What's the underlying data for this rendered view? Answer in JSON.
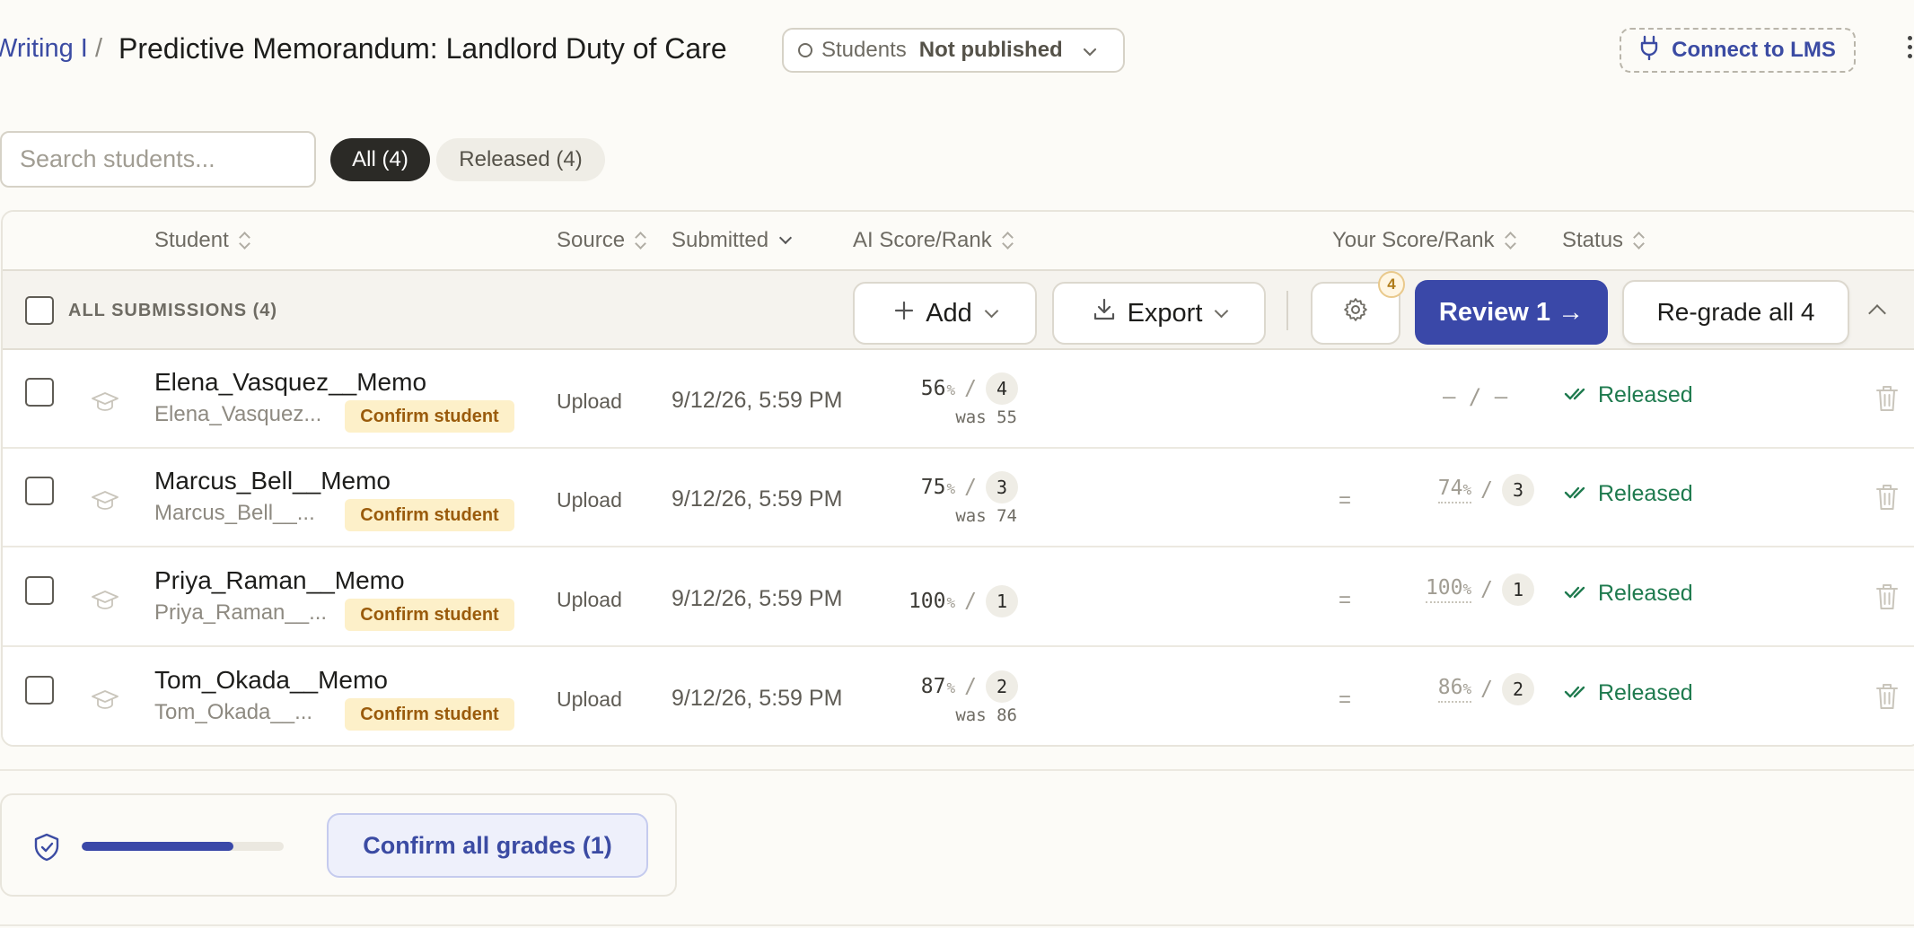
{
  "header": {
    "breadcrumb_parent": "Writing I",
    "breadcrumb_separator": "/",
    "title": "Predictive Memorandum: Landlord Duty of Care",
    "publish_audience": "Students",
    "publish_status": "Not published",
    "connect_lms_label": "Connect to LMS"
  },
  "filters": {
    "search_placeholder": "Search students...",
    "all_label": "All (4)",
    "released_label": "Released (4)"
  },
  "columns": {
    "student": "Student",
    "source": "Source",
    "submitted": "Submitted",
    "ai_score": "AI Score/Rank",
    "your_score": "Your Score/Rank",
    "status": "Status"
  },
  "toolbar": {
    "all_submissions": "ALL SUBMISSIONS (4)",
    "add_label": "Add",
    "export_label": "Export",
    "settings_badge": "4",
    "review_label": "Review 1 →",
    "regrade_label": "Re-grade all 4"
  },
  "rows": [
    {
      "file": "Elena_Vasquez__Memo",
      "sub": "Elena_Vasquez...",
      "confirm": "Confirm student",
      "source": "Upload",
      "submitted": "9/12/26, 5:59 PM",
      "ai_score": "56",
      "ai_rank": "4",
      "was": "was 55",
      "eq": "",
      "your_score": "",
      "your_rank": "",
      "your_empty": "– / –",
      "status": "Released"
    },
    {
      "file": "Marcus_Bell__Memo",
      "sub": "Marcus_Bell__...",
      "confirm": "Confirm student",
      "source": "Upload",
      "submitted": "9/12/26, 5:59 PM",
      "ai_score": "75",
      "ai_rank": "3",
      "was": "was 74",
      "eq": "=",
      "your_score": "74",
      "your_rank": "3",
      "your_empty": "",
      "status": "Released"
    },
    {
      "file": "Priya_Raman__Memo",
      "sub": "Priya_Raman__...",
      "confirm": "Confirm student",
      "source": "Upload",
      "submitted": "9/12/26, 5:59 PM",
      "ai_score": "100",
      "ai_rank": "1",
      "was": "",
      "eq": "=",
      "your_score": "100",
      "your_rank": "1",
      "your_empty": "",
      "status": "Released"
    },
    {
      "file": "Tom_Okada__Memo",
      "sub": "Tom_Okada__...",
      "confirm": "Confirm student",
      "source": "Upload",
      "submitted": "9/12/26, 5:59 PM",
      "ai_score": "87",
      "ai_rank": "2",
      "was": "was 86",
      "eq": "=",
      "your_score": "86",
      "your_rank": "2",
      "your_empty": "",
      "status": "Released"
    }
  ],
  "percent_sign": "%",
  "rank_separator": "/",
  "footer": {
    "confirm_all_label": "Confirm all grades (1)",
    "progress": 0.75
  },
  "colors": {
    "accent": "#3a48a8",
    "released": "#1e7a4e",
    "confirm_tag_bg": "#fdf0c9",
    "confirm_tag_text": "#9a5b0c"
  }
}
